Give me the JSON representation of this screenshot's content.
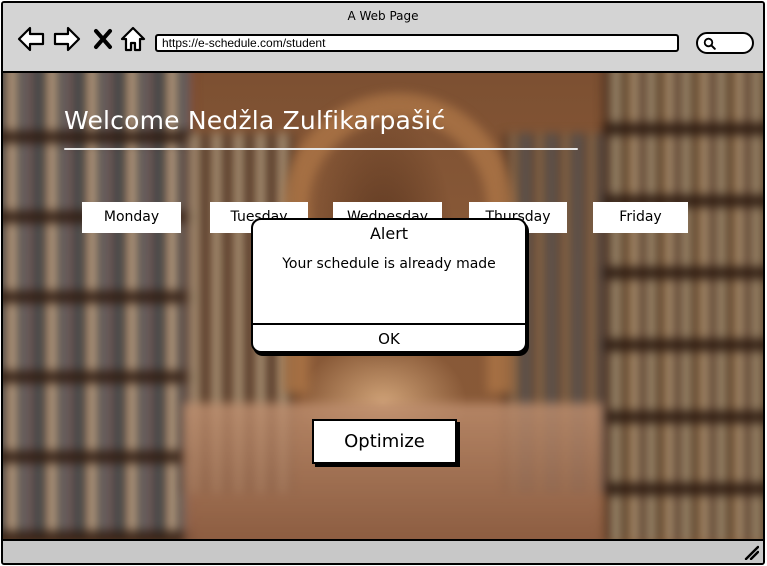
{
  "window": {
    "title": "A Web Page"
  },
  "browser": {
    "url": "https://e-schedule.com/student",
    "icons": [
      "back-arrow-icon",
      "forward-arrow-icon",
      "close-x-icon",
      "home-icon",
      "search-icon",
      "resize-grip-icon"
    ]
  },
  "page": {
    "welcome": "Welcome Nedžla Zulfikarpašić",
    "days": [
      "Monday",
      "Tuesday",
      "Wednesday",
      "Thursday",
      "Friday"
    ],
    "optimize_label": "Optimize"
  },
  "alert": {
    "title": "Alert",
    "message": "Your schedule is already made",
    "ok_label": "OK"
  }
}
